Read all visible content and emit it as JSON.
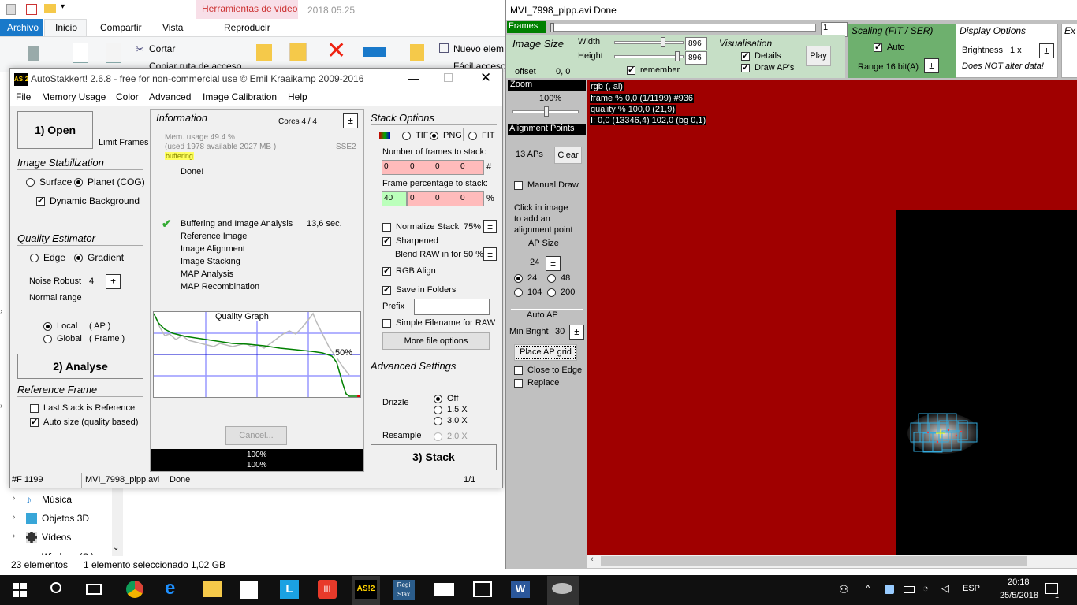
{
  "explorer": {
    "qa_date": "2018.05.25",
    "context_tab": "Herramientas de vídeo",
    "tabs": [
      "Archivo",
      "Inicio",
      "Compartir",
      "Vista"
    ],
    "context_sub": "Reproducir",
    "ribbon": {
      "cortar": "Cortar",
      "copiar_ruta": "Copiar ruta de acceso",
      "nuevo": "Nuevo elem",
      "facil": "Fácil acceso"
    },
    "nav": [
      {
        "label": "Música",
        "icon": "music-icon"
      },
      {
        "label": "Objetos 3D",
        "icon": "cube-icon"
      },
      {
        "label": "Vídeos",
        "icon": "film-icon"
      },
      {
        "label": "Windows (C:)",
        "icon": "drive-icon"
      }
    ],
    "status_count": "23 elementos",
    "status_sel": "1 elemento seleccionado",
    "status_size": "1,02 GB"
  },
  "autostakkert": {
    "logo": "AS!2",
    "title": "AutoStakkert! 2.6.8 - free for non-commercial use © Emil Kraaikamp 2009-2016",
    "menu": [
      "File",
      "Memory Usage",
      "Color",
      "Advanced",
      "Image Calibration",
      "Help"
    ],
    "open_button": "1) Open",
    "limit_frames": "Limit Frames",
    "image_stabilization": "Image Stabilization",
    "surface": "Surface",
    "planet": "Planet (COG)",
    "dynamic_bg": "Dynamic Background",
    "quality_estimator": "Quality Estimator",
    "edge": "Edge",
    "gradient": "Gradient",
    "noise_robust": "Noise Robust",
    "noise_value": "4",
    "normal_range": "Normal range",
    "local": "Local",
    "local_ap": "( AP )",
    "global": "Global",
    "global_frame": "( Frame )",
    "analyse_button": "2) Analyse",
    "reference_frame": "Reference Frame",
    "last_stack": "Last Stack is Reference",
    "auto_size": "Auto size (quality based)",
    "information": "Information",
    "cores": "Cores 4 / 4",
    "mem_usage": "Mem. usage 49.4 %",
    "mem_detail": "(used 1978 available 2027 MB )",
    "sse": "SSE2",
    "buffering": "buffering",
    "done": "Done!",
    "steps": [
      "Buffering and Image Analysis",
      "Reference Image",
      "Image Alignment",
      "Image Stacking",
      "MAP Analysis",
      "MAP Recombination"
    ],
    "step_time": "13,6 sec.",
    "quality_graph": "Quality Graph",
    "graph_pct": "50%",
    "cancel": "Cancel...",
    "progress1": "100%",
    "progress2": "100%",
    "stack_options": "Stack Options",
    "tif": "TIF",
    "png": "PNG",
    "fit": "FIT",
    "frames_to_stack": "Number of frames to stack:",
    "frames_values": [
      "0",
      "0",
      "0",
      "0"
    ],
    "hash": "#",
    "frame_pct": "Frame percentage to stack:",
    "pct_values": [
      "40",
      "0",
      "0",
      "0"
    ],
    "pct": "%",
    "normalize": "Normalize Stack",
    "normalize_val": "75%",
    "sharpened": "Sharpened",
    "blend_raw": "Blend RAW in for 50 %",
    "rgb_align": "RGB Align",
    "save_folders": "Save in Folders",
    "prefix": "Prefix",
    "simple_filename": "Simple Filename for RAW",
    "more_file_options": "More file options",
    "advanced_settings": "Advanced Settings",
    "drizzle": "Drizzle",
    "off": "Off",
    "x15": "1.5 X",
    "x30": "3.0 X",
    "resample": "Resample",
    "x20": "2.0 X",
    "stack_button": "3) Stack",
    "status_frame": "#F 1199",
    "status_file": "MVI_7998_pipp.avi",
    "status_done": "Done",
    "status_page": "1/1"
  },
  "viewer": {
    "title": "MVI_7998_pipp.avi   Done",
    "frames": "Frames",
    "frame_num": "1",
    "image_size": "Image Size",
    "width": "Width",
    "height": "Height",
    "width_val": "896",
    "height_val": "896",
    "offset": "offset",
    "offset_val": "0, 0",
    "remember": "remember",
    "visualisation": "Visualisation",
    "details": "Details",
    "draw_aps": "Draw AP's",
    "play": "Play",
    "scaling": "Scaling (FIT / SER)",
    "auto": "Auto",
    "range": "Range 16 bit(A)",
    "display_options": "Display Options",
    "brightness": "Brightness",
    "brightness_val": "1 x",
    "not_alter": "Does NOT alter data!",
    "ex": "Ex",
    "zoom": "Zoom",
    "zoom_val": "100%",
    "alignment_points": "Alignment Points",
    "aps_count": "13 APs",
    "clear": "Clear",
    "manual_draw": "Manual Draw",
    "click_hint": [
      "Click in image",
      "to add an",
      "alignment point"
    ],
    "ap_size": "AP Size",
    "ap_size_val": "24",
    "ap24": "24",
    "ap48": "48",
    "ap104": "104",
    "ap200": "200",
    "auto_ap": "Auto AP",
    "min_bright": "Min Bright",
    "min_bright_val": "30",
    "place_grid": "Place AP grid",
    "close_edge": "Close to Edge",
    "replace": "Replace",
    "overlay": [
      "rgb (, ai)",
      "frame % 0,0 (1/1199) #936",
      "quality % 100,0  (21,9)",
      "I: 0,0 (13346,4) 102,0 (bg 0,1)"
    ]
  },
  "taskbar": {
    "apps": [
      {
        "name": "chrome-icon",
        "label": ""
      },
      {
        "name": "edge-icon",
        "label": "e"
      },
      {
        "name": "explorer-icon",
        "label": ""
      },
      {
        "name": "store-icon",
        "label": ""
      },
      {
        "name": "l-app-icon",
        "label": "L"
      },
      {
        "name": "red-app-icon",
        "label": "III"
      },
      {
        "name": "autostakkert-icon",
        "label": "AS!2"
      },
      {
        "name": "registax-icon",
        "label": "Regi Stax"
      },
      {
        "name": "mail-icon",
        "label": ""
      },
      {
        "name": "photos-icon",
        "label": ""
      },
      {
        "name": "word-icon",
        "label": "W"
      },
      {
        "name": "pipp-icon",
        "label": ""
      }
    ],
    "lang": "ESP",
    "time": "20:18",
    "date": "25/5/2018",
    "notif": "1"
  }
}
